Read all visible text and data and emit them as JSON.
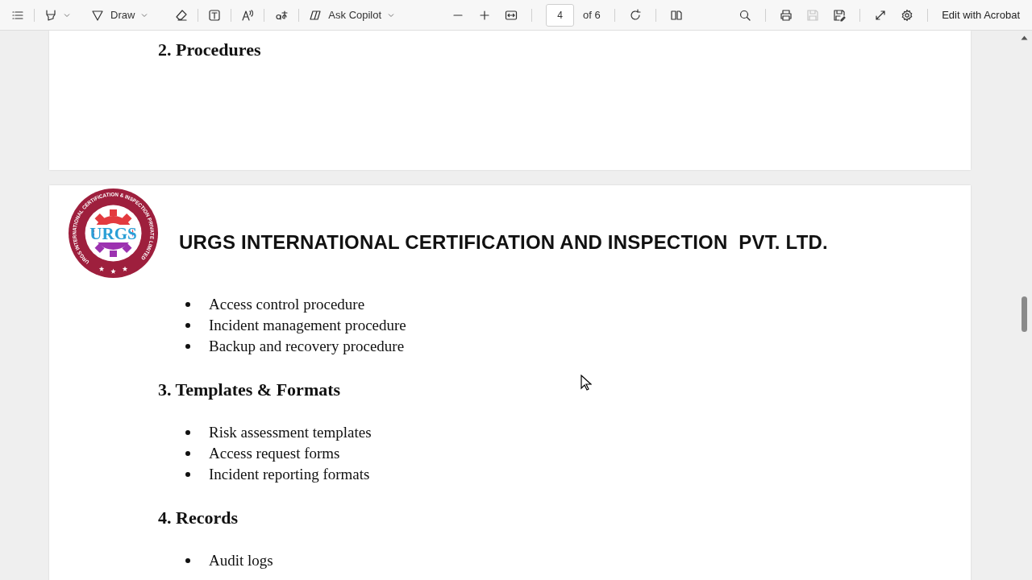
{
  "toolbar": {
    "draw_label": "Draw",
    "copilot_label": "Ask Copilot",
    "page_number": "4",
    "page_count": "of 6",
    "save_disabled": true,
    "edit_label": "Edit with Acrobat"
  },
  "previous_page": {
    "heading": "2. Procedures"
  },
  "page": {
    "logo": {
      "ring_text": "URGS INTERNATIONAL CERTIFICATION & INSPECTION PRIVATE LIMITED",
      "text": "URGS"
    },
    "company": "URGS INTERNATIONAL CERTIFICATION AND INSPECTION  PVT. LTD.",
    "blocks": [
      {
        "kind": "list",
        "items": [
          "Access control procedure",
          "Incident management procedure",
          "Backup and recovery procedure"
        ]
      },
      {
        "kind": "heading",
        "text": "3. Templates & Formats"
      },
      {
        "kind": "list",
        "items": [
          "Risk assessment templates",
          "Access request forms",
          "Incident reporting formats"
        ]
      },
      {
        "kind": "heading",
        "text": "4. Records"
      },
      {
        "kind": "list",
        "items": [
          "Audit logs"
        ]
      }
    ]
  }
}
